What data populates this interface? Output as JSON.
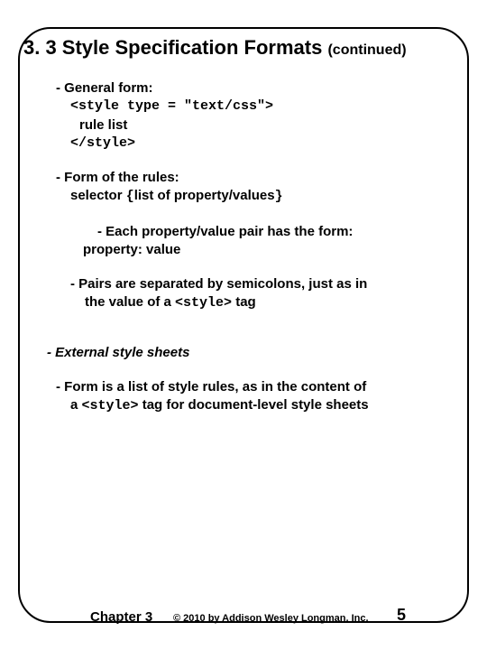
{
  "title_main": "3. 3 Style Specification Formats",
  "title_cont": "(continued)",
  "line_general": "- General form:",
  "code_open": "<style type = \"text/css\">",
  "code_rule": "rule list",
  "code_close": "</style>",
  "line_form_rules": "- Form of the rules:",
  "line_selector_a": "selector ",
  "line_selector_b": "{",
  "line_selector_c": "list of property/values",
  "line_selector_d": "}",
  "line_each_pair": "- Each property/value pair has the form:",
  "line_prop_val": "property: value",
  "line_pairs_sep1": "- Pairs are separated by semicolons, just as in",
  "line_pairs_sep2a": "the value of a ",
  "inline_style_tag": "<style>",
  "line_pairs_sep2b": " tag",
  "line_external": "- External style sheets",
  "line_ext_form1": "- Form is a list of style rules, as in the content of",
  "line_ext_form2a": "a ",
  "line_ext_form2b": " tag for document-level style sheets",
  "footer_chapter": "Chapter 3",
  "footer_copy": "© 2010 by Addison Wesley Longman, Inc.",
  "footer_page": "5"
}
